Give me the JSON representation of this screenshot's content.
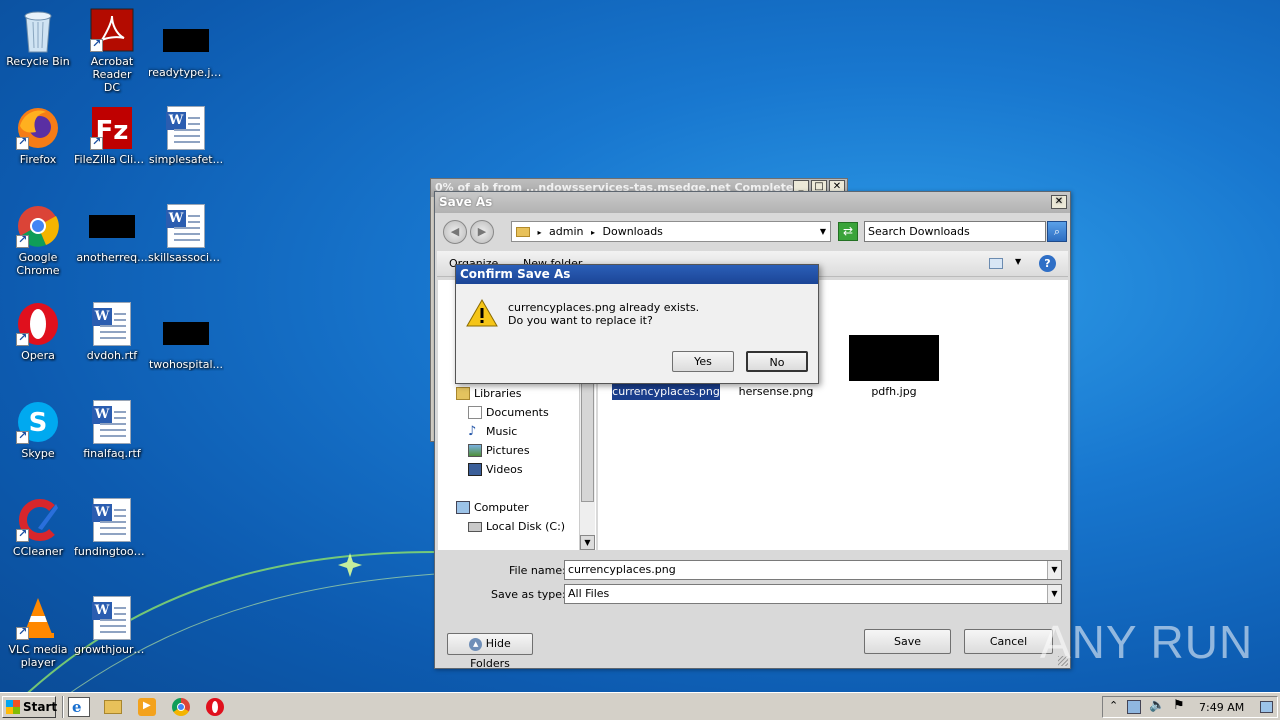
{
  "desktop": {
    "icons": [
      {
        "label": "Recycle Bin",
        "icon": "recycle-bin-icon"
      },
      {
        "label": "Acrobat Reader DC",
        "icon": "acrobat-icon"
      },
      {
        "label": "readytype.jpg",
        "icon": "image-thumbnail"
      },
      {
        "label": "Firefox",
        "icon": "firefox-icon"
      },
      {
        "label": "FileZilla Client",
        "icon": "filezilla-icon"
      },
      {
        "label": "simplesafet...",
        "icon": "word-doc-icon"
      },
      {
        "label": "Google Chrome",
        "icon": "chrome-icon"
      },
      {
        "label": "anotherreq...",
        "icon": "image-thumbnail"
      },
      {
        "label": "skillsassocia...",
        "icon": "word-doc-icon"
      },
      {
        "label": "Opera",
        "icon": "opera-icon"
      },
      {
        "label": "dvdoh.rtf",
        "icon": "word-doc-icon"
      },
      {
        "label": "twohospital...",
        "icon": "image-thumbnail"
      },
      {
        "label": "Skype",
        "icon": "skype-icon"
      },
      {
        "label": "finalfaq.rtf",
        "icon": "word-doc-icon"
      },
      {
        "label": "CCleaner",
        "icon": "ccleaner-icon"
      },
      {
        "label": "fundingtook...",
        "icon": "word-doc-icon"
      },
      {
        "label": "VLC media player",
        "icon": "vlc-icon"
      },
      {
        "label": "growthjourn...",
        "icon": "word-doc-icon"
      }
    ]
  },
  "bg_window": {
    "title": "0% of ab from ...ndowsservices-tas.msedge.net Completed"
  },
  "save_as": {
    "title": "Save As",
    "breadcrumb": [
      "admin",
      "Downloads"
    ],
    "search_placeholder": "Search Downloads",
    "organize_label": "Organize",
    "new_folder_label": "New folder",
    "nav": {
      "libraries": "Libraries",
      "documents": "Documents",
      "music": "Music",
      "pictures": "Pictures",
      "videos": "Videos",
      "computer": "Computer",
      "local_disk": "Local Disk (C:)"
    },
    "files": [
      {
        "name": "currencyplaces.png",
        "selected": true
      },
      {
        "name": "hersense.png",
        "selected": false
      },
      {
        "name": "pdfh.jpg",
        "selected": false
      }
    ],
    "file_name_label": "File name:",
    "file_name_value": "currencyplaces.png",
    "save_type_label": "Save as type:",
    "save_type_value": "All Files",
    "hide_folders_label": "Hide Folders",
    "save_label": "Save",
    "cancel_label": "Cancel"
  },
  "confirm": {
    "title": "Confirm Save As",
    "line1": "currencyplaces.png already exists.",
    "line2": "Do you want to replace it?",
    "yes_label": "Yes",
    "no_label": "No"
  },
  "taskbar": {
    "start_label": "Start",
    "clock": "7:49 AM"
  },
  "watermark": "ANY RUN"
}
